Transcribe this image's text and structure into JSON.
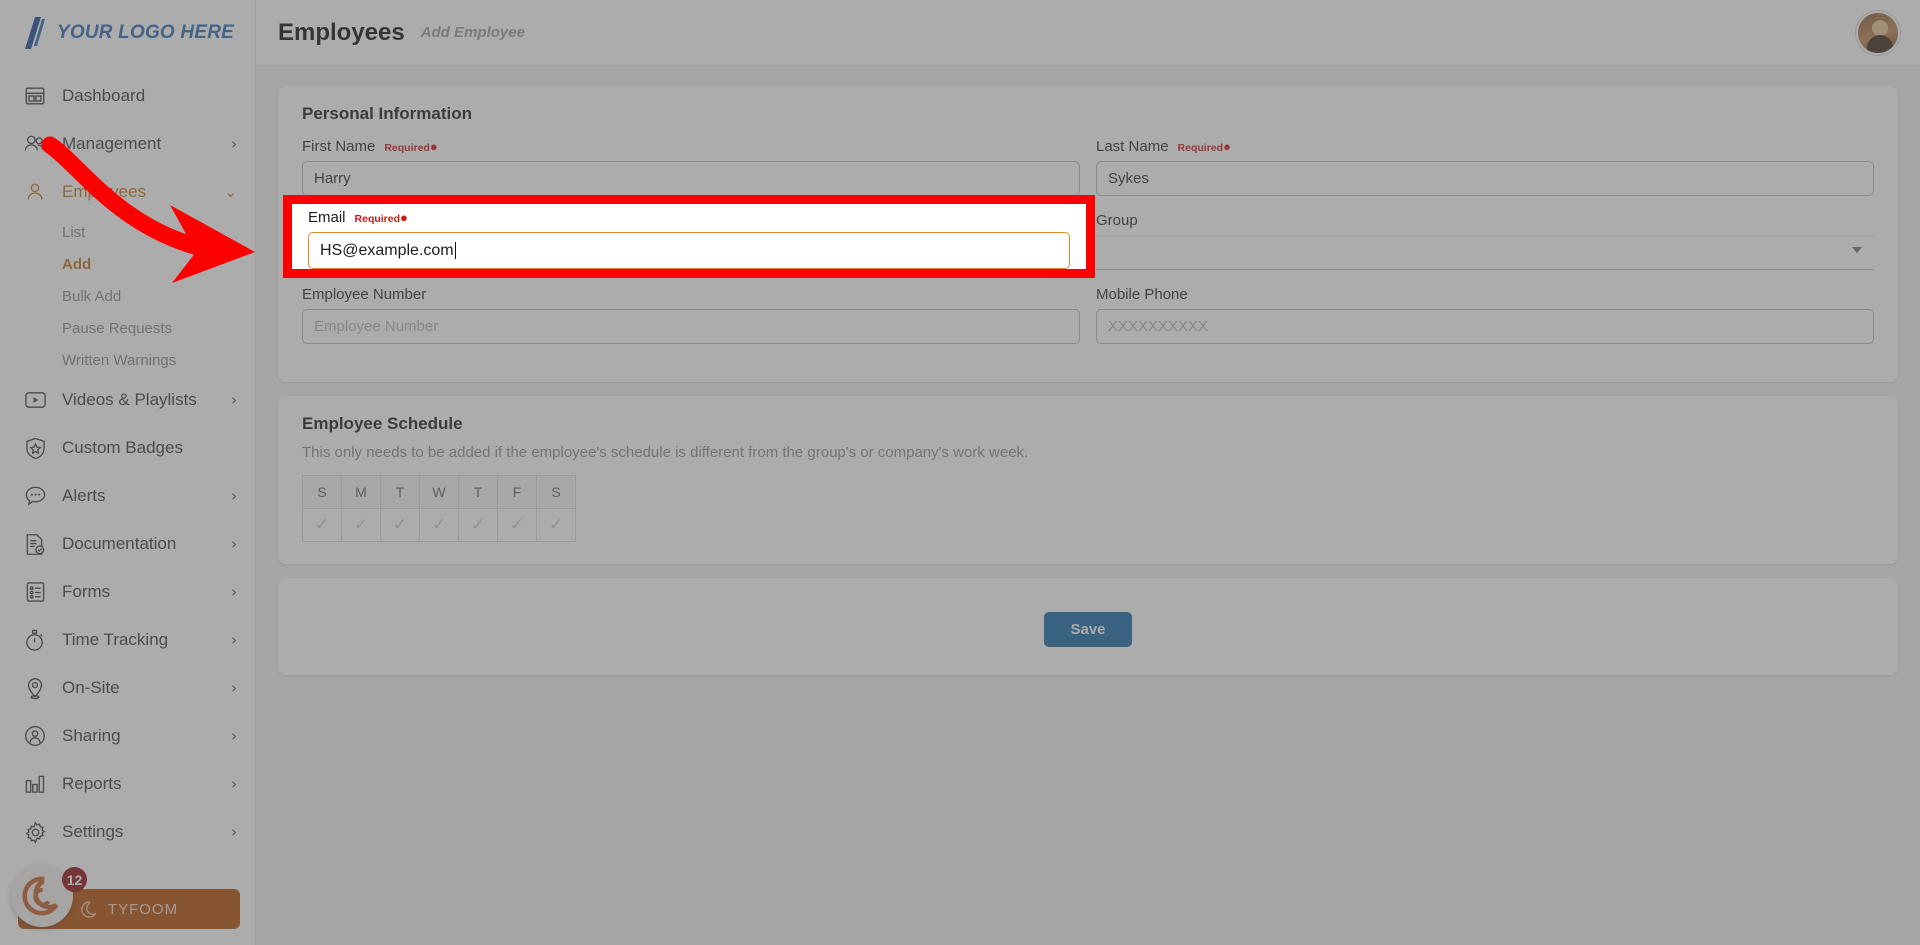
{
  "brand": {
    "logo_text": "YOUR LOGO HERE",
    "logo_color": "#2f6fb5",
    "accent_color": "#c4761a",
    "bottom_button_label": "TYFOOM",
    "bottom_button_badge": "12",
    "bottom_button_color": "#b4500a"
  },
  "sidebar": {
    "items": [
      {
        "label": "Dashboard",
        "icon": "dashboard-icon",
        "chevron": "",
        "active": false
      },
      {
        "label": "Management",
        "icon": "people-icon",
        "chevron": "›",
        "active": false
      },
      {
        "label": "Employees",
        "icon": "person-icon",
        "chevron": "⌄",
        "active": true
      }
    ],
    "employee_subitems": [
      {
        "label": "List",
        "current": false
      },
      {
        "label": "Add",
        "current": true
      },
      {
        "label": "Bulk Add",
        "current": false
      },
      {
        "label": "Pause Requests",
        "current": false
      },
      {
        "label": "Written Warnings",
        "current": false
      }
    ],
    "items_after": [
      {
        "label": "Videos & Playlists",
        "icon": "video-icon",
        "chevron": "›"
      },
      {
        "label": "Custom Badges",
        "icon": "badge-icon",
        "chevron": ""
      },
      {
        "label": "Alerts",
        "icon": "alert-icon",
        "chevron": "›"
      },
      {
        "label": "Documentation",
        "icon": "document-icon",
        "chevron": "›"
      },
      {
        "label": "Forms",
        "icon": "forms-icon",
        "chevron": "›"
      },
      {
        "label": "Time Tracking",
        "icon": "stopwatch-icon",
        "chevron": "›"
      },
      {
        "label": "On-Site",
        "icon": "pin-icon",
        "chevron": "›"
      },
      {
        "label": "Sharing",
        "icon": "share-icon",
        "chevron": "›"
      },
      {
        "label": "Reports",
        "icon": "chart-icon",
        "chevron": "›"
      },
      {
        "label": "Settings",
        "icon": "gear-icon",
        "chevron": "›"
      }
    ]
  },
  "topbar": {
    "title": "Employees",
    "subtitle": "Add Employee"
  },
  "personal_information": {
    "title": "Personal Information",
    "required_label": "Required",
    "first_name": {
      "label": "First Name",
      "value": "Harry",
      "placeholder": "First Name",
      "required": true
    },
    "last_name": {
      "label": "Last Name",
      "value": "Sykes",
      "placeholder": "Last Name",
      "required": true
    },
    "email": {
      "label": "Email",
      "value": "HS@example.com",
      "placeholder": "Email",
      "required": true
    },
    "group": {
      "label": "Group",
      "value": "",
      "placeholder": "",
      "required": false
    },
    "employee_number": {
      "label": "Employee Number",
      "value": "",
      "placeholder": "Employee Number",
      "required": false
    },
    "mobile_phone": {
      "label": "Mobile Phone",
      "value": "",
      "placeholder": "XXXXXXXXXX",
      "required": false
    }
  },
  "employee_schedule": {
    "title": "Employee Schedule",
    "description": "This only needs to be added if the employee's schedule is different from the group's or company's work week.",
    "days": [
      "S",
      "M",
      "T",
      "W",
      "T",
      "F",
      "S"
    ],
    "checked": [
      true,
      true,
      true,
      true,
      true,
      true,
      true
    ],
    "check_glyph": "✓"
  },
  "actions": {
    "save_label": "Save",
    "save_color": "#1a6aa8"
  },
  "annotation": {
    "arrow_color": "#ff0000",
    "highlight_border_color": "#ff0000",
    "focus_border_color": "#e08a2e"
  }
}
